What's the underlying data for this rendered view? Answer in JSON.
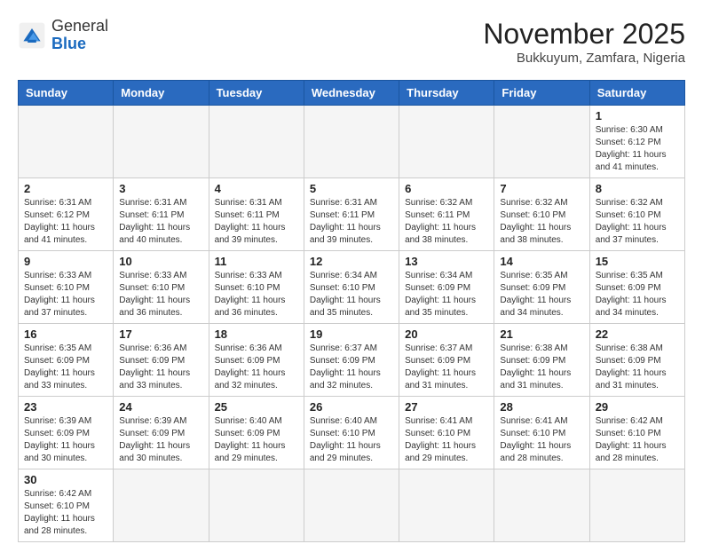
{
  "header": {
    "logo_general": "General",
    "logo_blue": "Blue",
    "month_title": "November 2025",
    "location": "Bukkuyum, Zamfara, Nigeria"
  },
  "weekdays": [
    "Sunday",
    "Monday",
    "Tuesday",
    "Wednesday",
    "Thursday",
    "Friday",
    "Saturday"
  ],
  "days": [
    {
      "day": "",
      "sunrise": "",
      "sunset": "",
      "daylight": ""
    },
    {
      "day": "",
      "sunrise": "",
      "sunset": "",
      "daylight": ""
    },
    {
      "day": "",
      "sunrise": "",
      "sunset": "",
      "daylight": ""
    },
    {
      "day": "",
      "sunrise": "",
      "sunset": "",
      "daylight": ""
    },
    {
      "day": "",
      "sunrise": "",
      "sunset": "",
      "daylight": ""
    },
    {
      "day": "",
      "sunrise": "",
      "sunset": "",
      "daylight": ""
    },
    {
      "day": "1",
      "sunrise": "Sunrise: 6:30 AM",
      "sunset": "Sunset: 6:12 PM",
      "daylight": "Daylight: 11 hours and 41 minutes."
    },
    {
      "day": "2",
      "sunrise": "Sunrise: 6:31 AM",
      "sunset": "Sunset: 6:12 PM",
      "daylight": "Daylight: 11 hours and 41 minutes."
    },
    {
      "day": "3",
      "sunrise": "Sunrise: 6:31 AM",
      "sunset": "Sunset: 6:11 PM",
      "daylight": "Daylight: 11 hours and 40 minutes."
    },
    {
      "day": "4",
      "sunrise": "Sunrise: 6:31 AM",
      "sunset": "Sunset: 6:11 PM",
      "daylight": "Daylight: 11 hours and 39 minutes."
    },
    {
      "day": "5",
      "sunrise": "Sunrise: 6:31 AM",
      "sunset": "Sunset: 6:11 PM",
      "daylight": "Daylight: 11 hours and 39 minutes."
    },
    {
      "day": "6",
      "sunrise": "Sunrise: 6:32 AM",
      "sunset": "Sunset: 6:11 PM",
      "daylight": "Daylight: 11 hours and 38 minutes."
    },
    {
      "day": "7",
      "sunrise": "Sunrise: 6:32 AM",
      "sunset": "Sunset: 6:10 PM",
      "daylight": "Daylight: 11 hours and 38 minutes."
    },
    {
      "day": "8",
      "sunrise": "Sunrise: 6:32 AM",
      "sunset": "Sunset: 6:10 PM",
      "daylight": "Daylight: 11 hours and 37 minutes."
    },
    {
      "day": "9",
      "sunrise": "Sunrise: 6:33 AM",
      "sunset": "Sunset: 6:10 PM",
      "daylight": "Daylight: 11 hours and 37 minutes."
    },
    {
      "day": "10",
      "sunrise": "Sunrise: 6:33 AM",
      "sunset": "Sunset: 6:10 PM",
      "daylight": "Daylight: 11 hours and 36 minutes."
    },
    {
      "day": "11",
      "sunrise": "Sunrise: 6:33 AM",
      "sunset": "Sunset: 6:10 PM",
      "daylight": "Daylight: 11 hours and 36 minutes."
    },
    {
      "day": "12",
      "sunrise": "Sunrise: 6:34 AM",
      "sunset": "Sunset: 6:10 PM",
      "daylight": "Daylight: 11 hours and 35 minutes."
    },
    {
      "day": "13",
      "sunrise": "Sunrise: 6:34 AM",
      "sunset": "Sunset: 6:09 PM",
      "daylight": "Daylight: 11 hours and 35 minutes."
    },
    {
      "day": "14",
      "sunrise": "Sunrise: 6:35 AM",
      "sunset": "Sunset: 6:09 PM",
      "daylight": "Daylight: 11 hours and 34 minutes."
    },
    {
      "day": "15",
      "sunrise": "Sunrise: 6:35 AM",
      "sunset": "Sunset: 6:09 PM",
      "daylight": "Daylight: 11 hours and 34 minutes."
    },
    {
      "day": "16",
      "sunrise": "Sunrise: 6:35 AM",
      "sunset": "Sunset: 6:09 PM",
      "daylight": "Daylight: 11 hours and 33 minutes."
    },
    {
      "day": "17",
      "sunrise": "Sunrise: 6:36 AM",
      "sunset": "Sunset: 6:09 PM",
      "daylight": "Daylight: 11 hours and 33 minutes."
    },
    {
      "day": "18",
      "sunrise": "Sunrise: 6:36 AM",
      "sunset": "Sunset: 6:09 PM",
      "daylight": "Daylight: 11 hours and 32 minutes."
    },
    {
      "day": "19",
      "sunrise": "Sunrise: 6:37 AM",
      "sunset": "Sunset: 6:09 PM",
      "daylight": "Daylight: 11 hours and 32 minutes."
    },
    {
      "day": "20",
      "sunrise": "Sunrise: 6:37 AM",
      "sunset": "Sunset: 6:09 PM",
      "daylight": "Daylight: 11 hours and 31 minutes."
    },
    {
      "day": "21",
      "sunrise": "Sunrise: 6:38 AM",
      "sunset": "Sunset: 6:09 PM",
      "daylight": "Daylight: 11 hours and 31 minutes."
    },
    {
      "day": "22",
      "sunrise": "Sunrise: 6:38 AM",
      "sunset": "Sunset: 6:09 PM",
      "daylight": "Daylight: 11 hours and 31 minutes."
    },
    {
      "day": "23",
      "sunrise": "Sunrise: 6:39 AM",
      "sunset": "Sunset: 6:09 PM",
      "daylight": "Daylight: 11 hours and 30 minutes."
    },
    {
      "day": "24",
      "sunrise": "Sunrise: 6:39 AM",
      "sunset": "Sunset: 6:09 PM",
      "daylight": "Daylight: 11 hours and 30 minutes."
    },
    {
      "day": "25",
      "sunrise": "Sunrise: 6:40 AM",
      "sunset": "Sunset: 6:09 PM",
      "daylight": "Daylight: 11 hours and 29 minutes."
    },
    {
      "day": "26",
      "sunrise": "Sunrise: 6:40 AM",
      "sunset": "Sunset: 6:10 PM",
      "daylight": "Daylight: 11 hours and 29 minutes."
    },
    {
      "day": "27",
      "sunrise": "Sunrise: 6:41 AM",
      "sunset": "Sunset: 6:10 PM",
      "daylight": "Daylight: 11 hours and 29 minutes."
    },
    {
      "day": "28",
      "sunrise": "Sunrise: 6:41 AM",
      "sunset": "Sunset: 6:10 PM",
      "daylight": "Daylight: 11 hours and 28 minutes."
    },
    {
      "day": "29",
      "sunrise": "Sunrise: 6:42 AM",
      "sunset": "Sunset: 6:10 PM",
      "daylight": "Daylight: 11 hours and 28 minutes."
    },
    {
      "day": "30",
      "sunrise": "Sunrise: 6:42 AM",
      "sunset": "Sunset: 6:10 PM",
      "daylight": "Daylight: 11 hours and 28 minutes."
    }
  ]
}
